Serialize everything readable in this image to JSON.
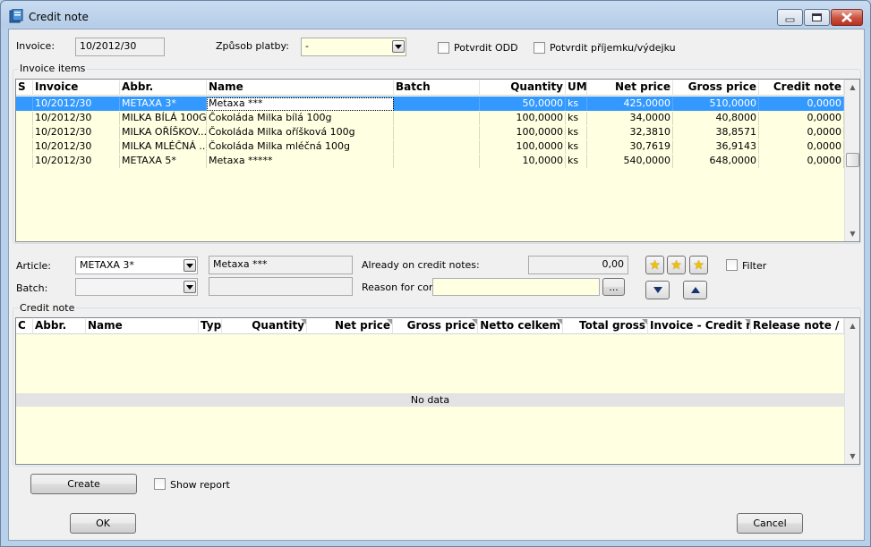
{
  "window": {
    "title": "Credit note"
  },
  "header": {
    "invoice_label": "Invoice:",
    "invoice_value": "10/2012/30",
    "payment_label": "Způsob platby:",
    "payment_value": "-",
    "confirm_odd_label": "Potvrdit ODD",
    "confirm_receipt_label": "Potvrdit příjemku/výdejku"
  },
  "invoice_items": {
    "title": "Invoice items",
    "columns": [
      "S",
      "Invoice",
      "Abbr.",
      "Name",
      "Batch",
      "Quantity",
      "UM",
      "Net price",
      "Gross price",
      "Credit note"
    ],
    "rows": [
      [
        "",
        "10/2012/30",
        "METAXA 3*",
        "Metaxa ***",
        "",
        "50,0000",
        "ks",
        "425,0000",
        "510,0000",
        "0,0000"
      ],
      [
        "",
        "10/2012/30",
        "MILKA BÍLÁ 100G",
        "Čokoláda Milka bílá 100g",
        "",
        "100,0000",
        "ks",
        "34,0000",
        "40,8000",
        "0,0000"
      ],
      [
        "",
        "10/2012/30",
        "MILKA OŘÍŠKOV...",
        "Čokoláda Milka oříšková 100g",
        "",
        "100,0000",
        "ks",
        "32,3810",
        "38,8571",
        "0,0000"
      ],
      [
        "",
        "10/2012/30",
        "MILKA MLÉČNÁ ...",
        "Čokoláda Milka mléčná 100g",
        "",
        "100,0000",
        "ks",
        "30,7619",
        "36,9143",
        "0,0000"
      ],
      [
        "",
        "10/2012/30",
        "METAXA 5*",
        "Metaxa *****",
        "",
        "10,0000",
        "ks",
        "540,0000",
        "648,0000",
        "0,0000"
      ]
    ]
  },
  "article_panel": {
    "article_label": "Article:",
    "article_value": "METAXA 3*",
    "article_name": "Metaxa ***",
    "batch_label": "Batch:",
    "batch_value": "",
    "batch_name": "",
    "already_label": "Already on credit notes:",
    "already_value": "0,00",
    "reason_label": "Reason for corre",
    "reason_value": "",
    "ellipsis_label": "...",
    "filter_label": "Filter"
  },
  "credit_note": {
    "title": "Credit note",
    "columns": [
      "C",
      "Abbr.",
      "Name",
      "Typ",
      "Quantity",
      "Net price",
      "Gross price",
      "Netto celkem",
      "Total gross",
      "Invoice - Credit n",
      "Release note /"
    ],
    "empty_text": "No data"
  },
  "footer": {
    "create_label": "Create",
    "show_report_label": "Show report",
    "ok_label": "OK",
    "cancel_label": "Cancel"
  },
  "colors": {
    "selection": "#3399ff",
    "grid_background": "#ffffe1"
  }
}
